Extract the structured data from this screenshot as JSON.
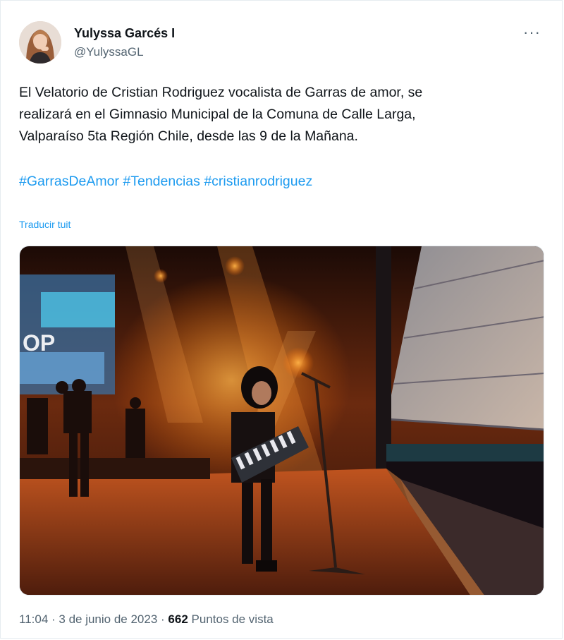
{
  "author": {
    "name": "Yulyssa Garcés I",
    "handle": "@YulyssaGL"
  },
  "more_label": "···",
  "tweet": {
    "text_lines": [
      "El Velatorio de Cristian Rodriguez vocalista de Garras de amor, se",
      "realizará en el Gimnasio Municipal de la Comuna de Calle Larga,",
      "Valparaíso 5ta Región Chile, desde las 9 de la Mañana."
    ],
    "hashtags": [
      "#GarrasDeAmor",
      "#Tendencias",
      "#cristianrodriguez"
    ],
    "translate_label": "Traducir tuit"
  },
  "meta": {
    "time": "11:04",
    "separator": " · ",
    "date": "3 de junio de 2023",
    "views": "662",
    "views_label": "Puntos de vista"
  },
  "colors": {
    "link": "#1d9bf0",
    "secondary_text": "#536471",
    "primary_text": "#0f1419"
  }
}
